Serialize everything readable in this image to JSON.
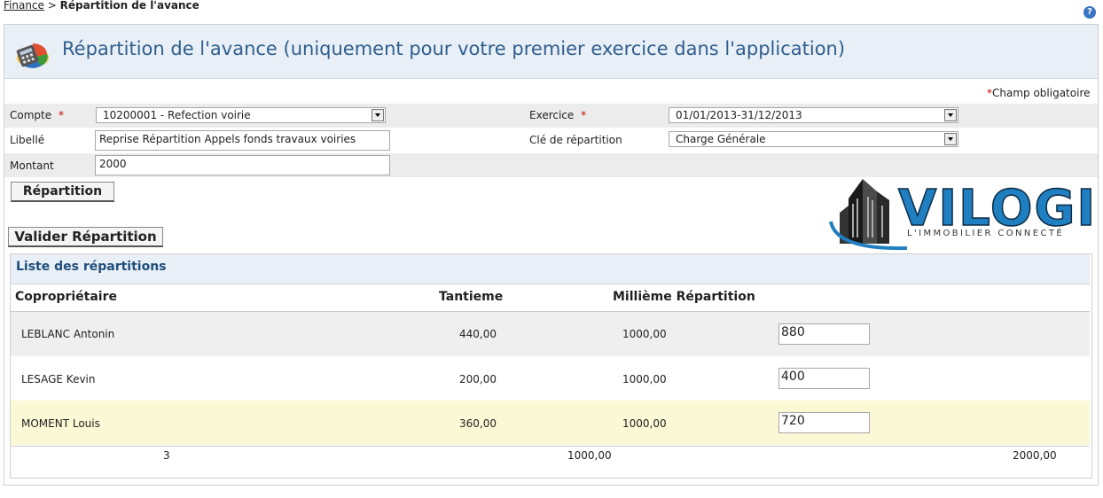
{
  "breadcrumb": {
    "parent": "Finance",
    "separator": ">",
    "current": "Répartition de l'avance"
  },
  "help_glyph": "?",
  "header": {
    "title": "Répartition de l'avance (uniquement pour votre premier exercice dans l'application)"
  },
  "required_note": {
    "star": "*",
    "text": "Champ obligatoire"
  },
  "form": {
    "compte": {
      "label": "Compte",
      "star": "*",
      "value": "10200001 - Refection voirie"
    },
    "exercice": {
      "label": "Exercice",
      "star": "*",
      "value": "01/01/2013-31/12/2013"
    },
    "libelle": {
      "label": "Libellé",
      "value": "Reprise Répartition Appels fonds travaux voiries"
    },
    "cle": {
      "label": "Clé de répartition",
      "value": "Charge Générale"
    },
    "montant": {
      "label": "Montant",
      "value": "2000"
    }
  },
  "buttons": {
    "repartition": "Répartition",
    "valider": "Valider Répartition"
  },
  "logo": {
    "brand": "VILOGI",
    "tagline": "L'IMMOBILIER CONNECTÉ",
    "color": "#1f7fc0"
  },
  "list": {
    "title": "Liste des répartitions",
    "columns": {
      "owner": "Copropriétaire",
      "tantieme": "Tantieme",
      "millieme": "Millième Répartition"
    },
    "rows": [
      {
        "owner": "LEBLANC Antonin",
        "tantieme": "440,00",
        "millieme": "1000,00",
        "amount": "880"
      },
      {
        "owner": "LESAGE Kevin",
        "tantieme": "200,00",
        "millieme": "1000,00",
        "amount": "400"
      },
      {
        "owner": "MOMENT Louis",
        "tantieme": "360,00",
        "millieme": "1000,00",
        "amount": "720"
      }
    ],
    "footer": {
      "count": "3",
      "total_tantieme": "1000,00",
      "total_amount": "2000,00"
    }
  },
  "colors": {
    "header_bg": "#e8eff6",
    "title_blue": "#2f5e8e",
    "row_highlight": "#fbf8d5",
    "row_grey": "#efefef"
  }
}
